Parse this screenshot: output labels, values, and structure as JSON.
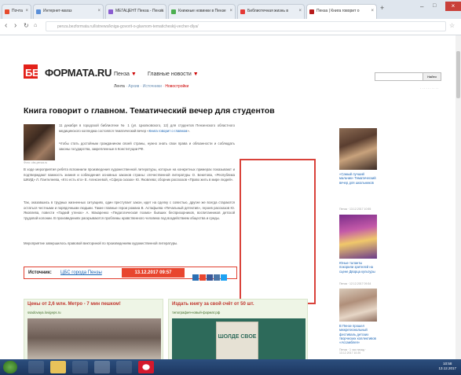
{
  "browser": {
    "tabs": [
      {
        "label": "Почта",
        "color": "#e64b2e"
      },
      {
        "label": "Интернет-магаз",
        "color": "#5a8fd8"
      },
      {
        "label": "МЕГАЦЕНТ Пенза - Пенза",
        "color": "#8a5cd0"
      },
      {
        "label": "Книжные новинки в Пензе",
        "color": "#4caf50"
      },
      {
        "label": "Библиотечная жизнь в",
        "color": "#e53935"
      },
      {
        "label": "Пенза | Книга говорит о",
        "color": "#b71c1c"
      }
    ],
    "url": "penza.bezformata.ru/listnews/kniga-govorit-o-glavnom-tematicheskij-vecher-dlya/"
  },
  "site": {
    "logo_prefix": "БЕЗ",
    "logo_rest": "ФОРМАТА.RU",
    "city_menu": "Пенза",
    "main_news_menu": "Главные новости",
    "sub_nav": [
      "Лента",
      "Архив",
      "Источники",
      "Новостройки"
    ],
    "search_button": "Найти"
  },
  "article": {
    "title": "Книга говорит о главном. Тематический вечер для студентов",
    "photo_caption": "Фото: cbs-penza.ru",
    "p1": "11 декабря в городской библиотеке № 1 (ул. Циолковского, 12) для студентов Пензенского областного медицинского колледжа состоялся тематический вечер «",
    "p1_link": "Книга говорит о главном",
    "p1_end": "».",
    "p2": "Чтобы стать достойным гражданином своей страны, нужно знать свои права и обязанности и соблюдать законы государства, закрепленные в Конституции РФ.",
    "p3": "В ходе мероприятия ребята вспомнили произведения художественной литературы, которые на конкретных примерах показывают и подтверждают важность знания и соблюдения основных законов страны: отечественной литературы О. Бекетова, «Республика ШКИД» Л. Пантелеева, «Кто есть кто» Е. Алексеевой, «Сфера сказок» Ю. Яковлева; сборник рассказов «Право жить в мире людей».",
    "p4": "Так, оказавшись в трудных жизненных ситуациях, один преступает закон, идет на сделку с совестью, другие же всегда стараются остаться честными и порядочными людьми. Такие главные герои романа В. Астафьева «Печальный детектив», героев рассказов Ю. Яковлева, повести «Гадкий утенок» А. Макаренко «Педагогическая поэма» бывших беспризорников, воспитанников детской трудовой колонии. В произведениях раскрываются проблемы нравственного человека под воздействием общества и среды.",
    "p5": "Мероприятие завершилось правовой викториной по произведениям художественной литературы.",
    "source_label": "Источник:",
    "source_name": "ЦБС города Пензы",
    "source_date": "13.12.2017 09:57"
  },
  "sidebar": [
    {
      "caption": "«Самый лучший мальчик» Тематический вечер для школьников",
      "meta": "Пенза · 13.12.2017 10:55"
    },
    {
      "caption": "Юные таланты покорили зрителей на сцене Дворца культуры",
      "meta": "Пенза · 12.12.2017 09:34"
    },
    {
      "caption": "В Пензе прошел межрегиональный фестиваль детских творческих коллективов «Ассамблея»",
      "meta": "Пенза · 1 час назад · 13.12.2017 10:20"
    }
  ],
  "widgets": [
    {
      "title": "Цены от 2,6 млн. Метро - 7 мин пешком!",
      "source": "ssadovaya.lovigeps.ru"
    },
    {
      "title": "Издать книгу за свой счёт от 50 шт.",
      "source": "типография-новый-формат.рф"
    }
  ],
  "book_cover_text": "ШОЛДЕ СВОЕ",
  "taskbar": {
    "time": "10:58",
    "date": "13.12.2017"
  },
  "colors": {
    "brand_red": "#e32119",
    "link_blue": "#1a64b4",
    "source_date_bg": "#e8462f",
    "ad_border": "#d9423a"
  }
}
